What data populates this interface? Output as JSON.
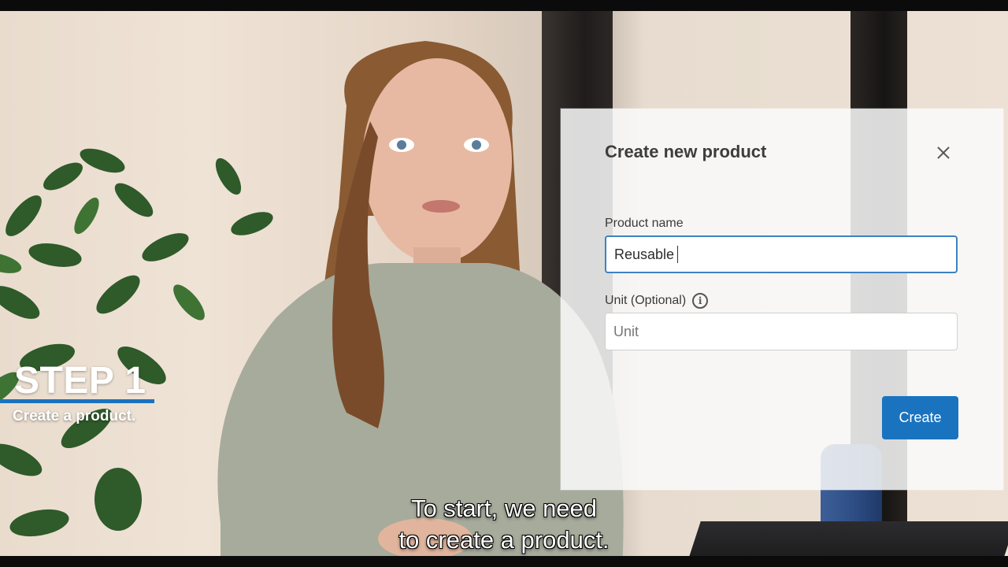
{
  "overlay": {
    "step_title": "STEP 1",
    "step_subtitle": "Create a product.",
    "accent_color": "#1a73bf"
  },
  "dialog": {
    "title": "Create new product",
    "close_icon": "close-icon",
    "product_name_label": "Product name",
    "product_name_value": "Reusable",
    "unit_label": "Unit (Optional)",
    "unit_info_icon": "info-icon",
    "unit_info_glyph": "i",
    "unit_placeholder": "Unit",
    "create_label": "Create"
  },
  "captions": {
    "line1": "To start, we need",
    "line2": "to create a product."
  }
}
